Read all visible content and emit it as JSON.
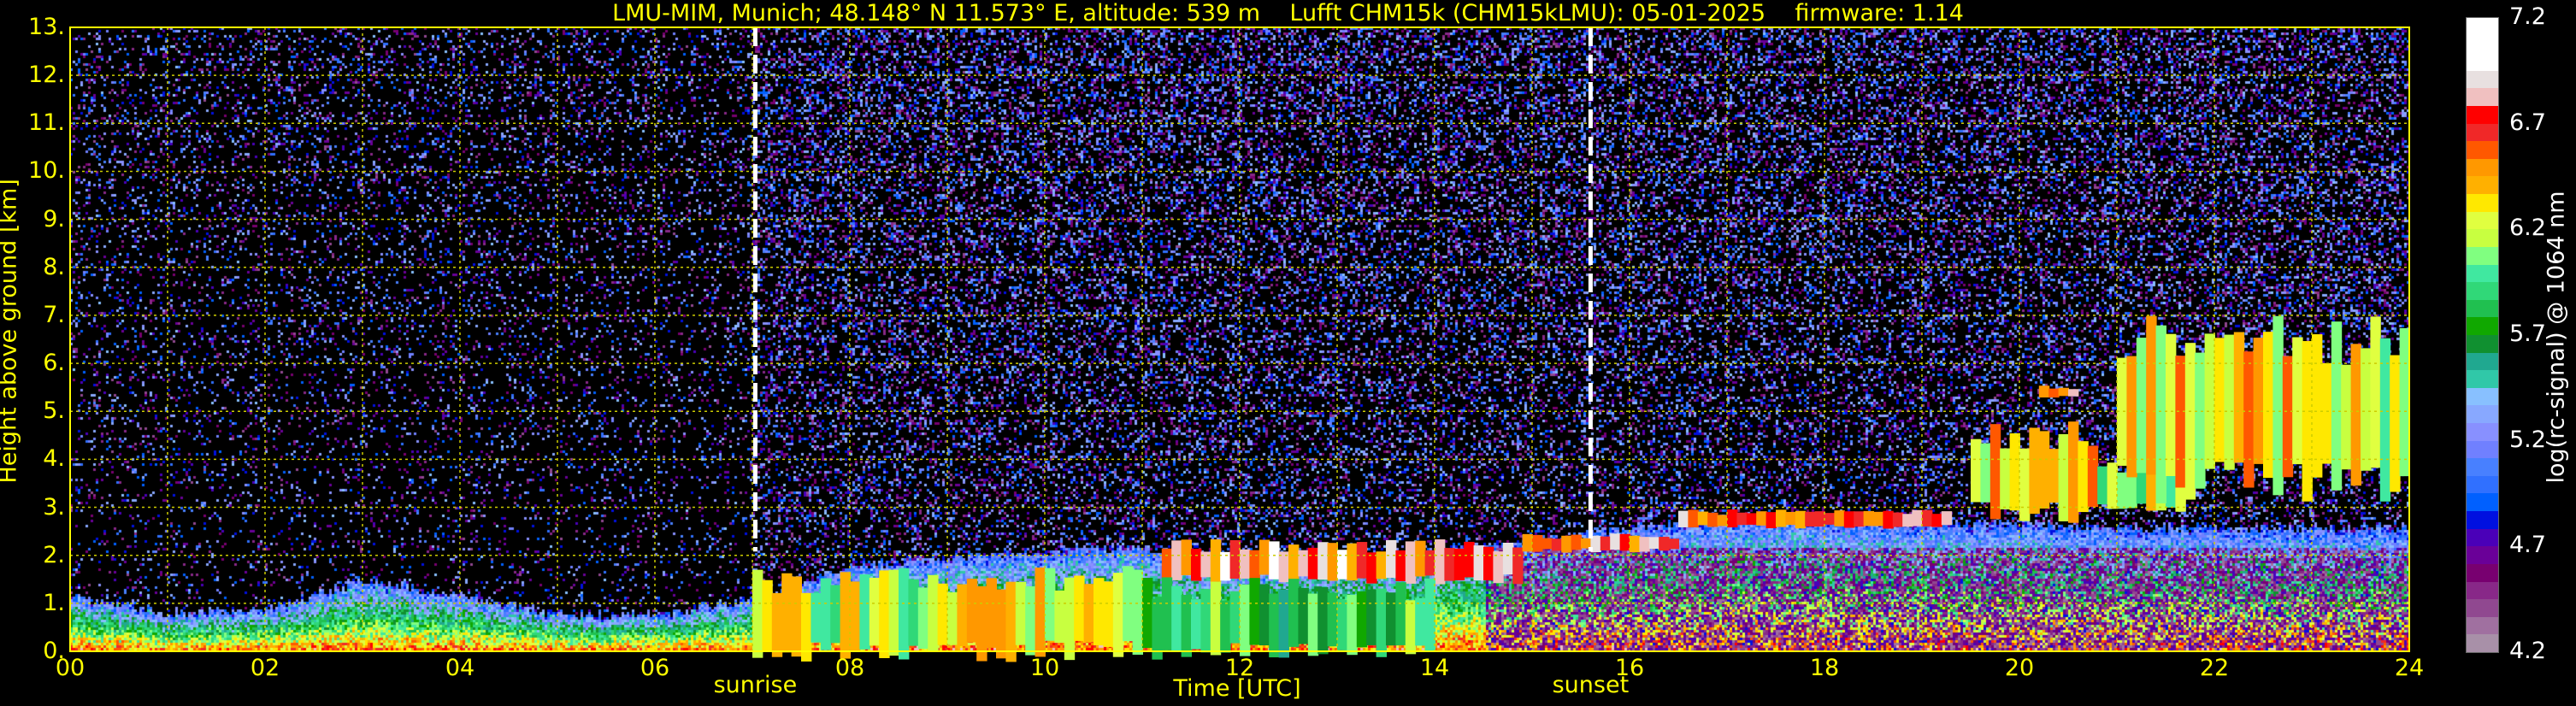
{
  "title": "LMU-MIM, Munich; 48.148° N 11.573° E, altitude: 539 m    Lufft CHM15k (CHM15kLMU): 05-01-2025    firmware: 1.14",
  "chart_data": {
    "type": "heatmap",
    "xlabel": "Time [UTC]",
    "ylabel": "Height above ground [km]",
    "xlim": [
      0,
      24
    ],
    "ylim": [
      0,
      13
    ],
    "xticks": [
      "00",
      "02",
      "04",
      "06",
      "08",
      "10",
      "12",
      "14",
      "16",
      "18",
      "20",
      "22",
      "24"
    ],
    "yticks": [
      "0.",
      "1.",
      "2.",
      "3.",
      "4.",
      "5.",
      "6.",
      "7.",
      "8.",
      "9.",
      "10.",
      "11.",
      "12.",
      "13."
    ],
    "grid": true,
    "events": [
      {
        "label": "sunrise",
        "time": 7.03
      },
      {
        "label": "sunset",
        "time": 15.6
      }
    ],
    "aerosol_layer_top_km": [
      1.2,
      0.8,
      0.9,
      1.5,
      1.2,
      0.8,
      0.8,
      1.1,
      1.8,
      2.0,
      2.1,
      2.2,
      1.8,
      2.0,
      2.1,
      2.3,
      2.6,
      2.8,
      2.8,
      2.7,
      2.7,
      2.6,
      2.6,
      2.6,
      2.6
    ],
    "cloud_features": [
      {
        "t0": 11.2,
        "t1": 14.9,
        "base": 1.5,
        "top": 2.2,
        "value": 7.0
      },
      {
        "t0": 14.9,
        "t1": 16.5,
        "base": 2.1,
        "top": 2.4,
        "value": 7.0
      },
      {
        "t0": 16.5,
        "t1": 19.3,
        "base": 2.6,
        "top": 2.9,
        "value": 6.9
      },
      {
        "t0": 19.5,
        "t1": 20.8,
        "base": 2.9,
        "top": 4.5,
        "value": 6.6
      },
      {
        "t0": 20.8,
        "t1": 21.7,
        "base": 3.0,
        "top": 3.9,
        "value": 6.4
      },
      {
        "t0": 21.0,
        "t1": 24.0,
        "base": 3.5,
        "top": 6.5,
        "value": 6.6
      },
      {
        "t0": 20.2,
        "t1": 20.6,
        "base": 5.3,
        "top": 5.5,
        "value": 7.0
      },
      {
        "t0": 7.0,
        "t1": 11.0,
        "base": 0.0,
        "top": 1.5,
        "value": 6.5
      },
      {
        "t0": 11.0,
        "t1": 14.0,
        "base": 0.0,
        "top": 1.3,
        "value": 6.2
      }
    ],
    "colorbar": {
      "label": "log(rc-signal) @ 1064 nm",
      "ticks": [
        "7.2",
        "6.7",
        "6.2",
        "5.7",
        "5.2",
        "4.7",
        "4.2"
      ],
      "range": [
        4.2,
        7.2
      ],
      "colors": [
        "#a890a8",
        "#a070a0",
        "#904890",
        "#882888",
        "#780070",
        "#6a0098",
        "#4a00b8",
        "#0010e0",
        "#0060ff",
        "#3070ff",
        "#4880ff",
        "#7080ff",
        "#8890ff",
        "#88a8ff",
        "#88c0ff",
        "#30c8a8",
        "#20a890",
        "#109030",
        "#10a800",
        "#20c050",
        "#30d878",
        "#40e8a0",
        "#80ff80",
        "#c8ff40",
        "#e0ff40",
        "#ffe800",
        "#ffb000",
        "#ff9800",
        "#ff5800",
        "#f02828",
        "#ff0000",
        "#f0c0c0",
        "#e8e0e0",
        "#ffffff",
        "#ffffff",
        "#ffffff"
      ]
    }
  }
}
